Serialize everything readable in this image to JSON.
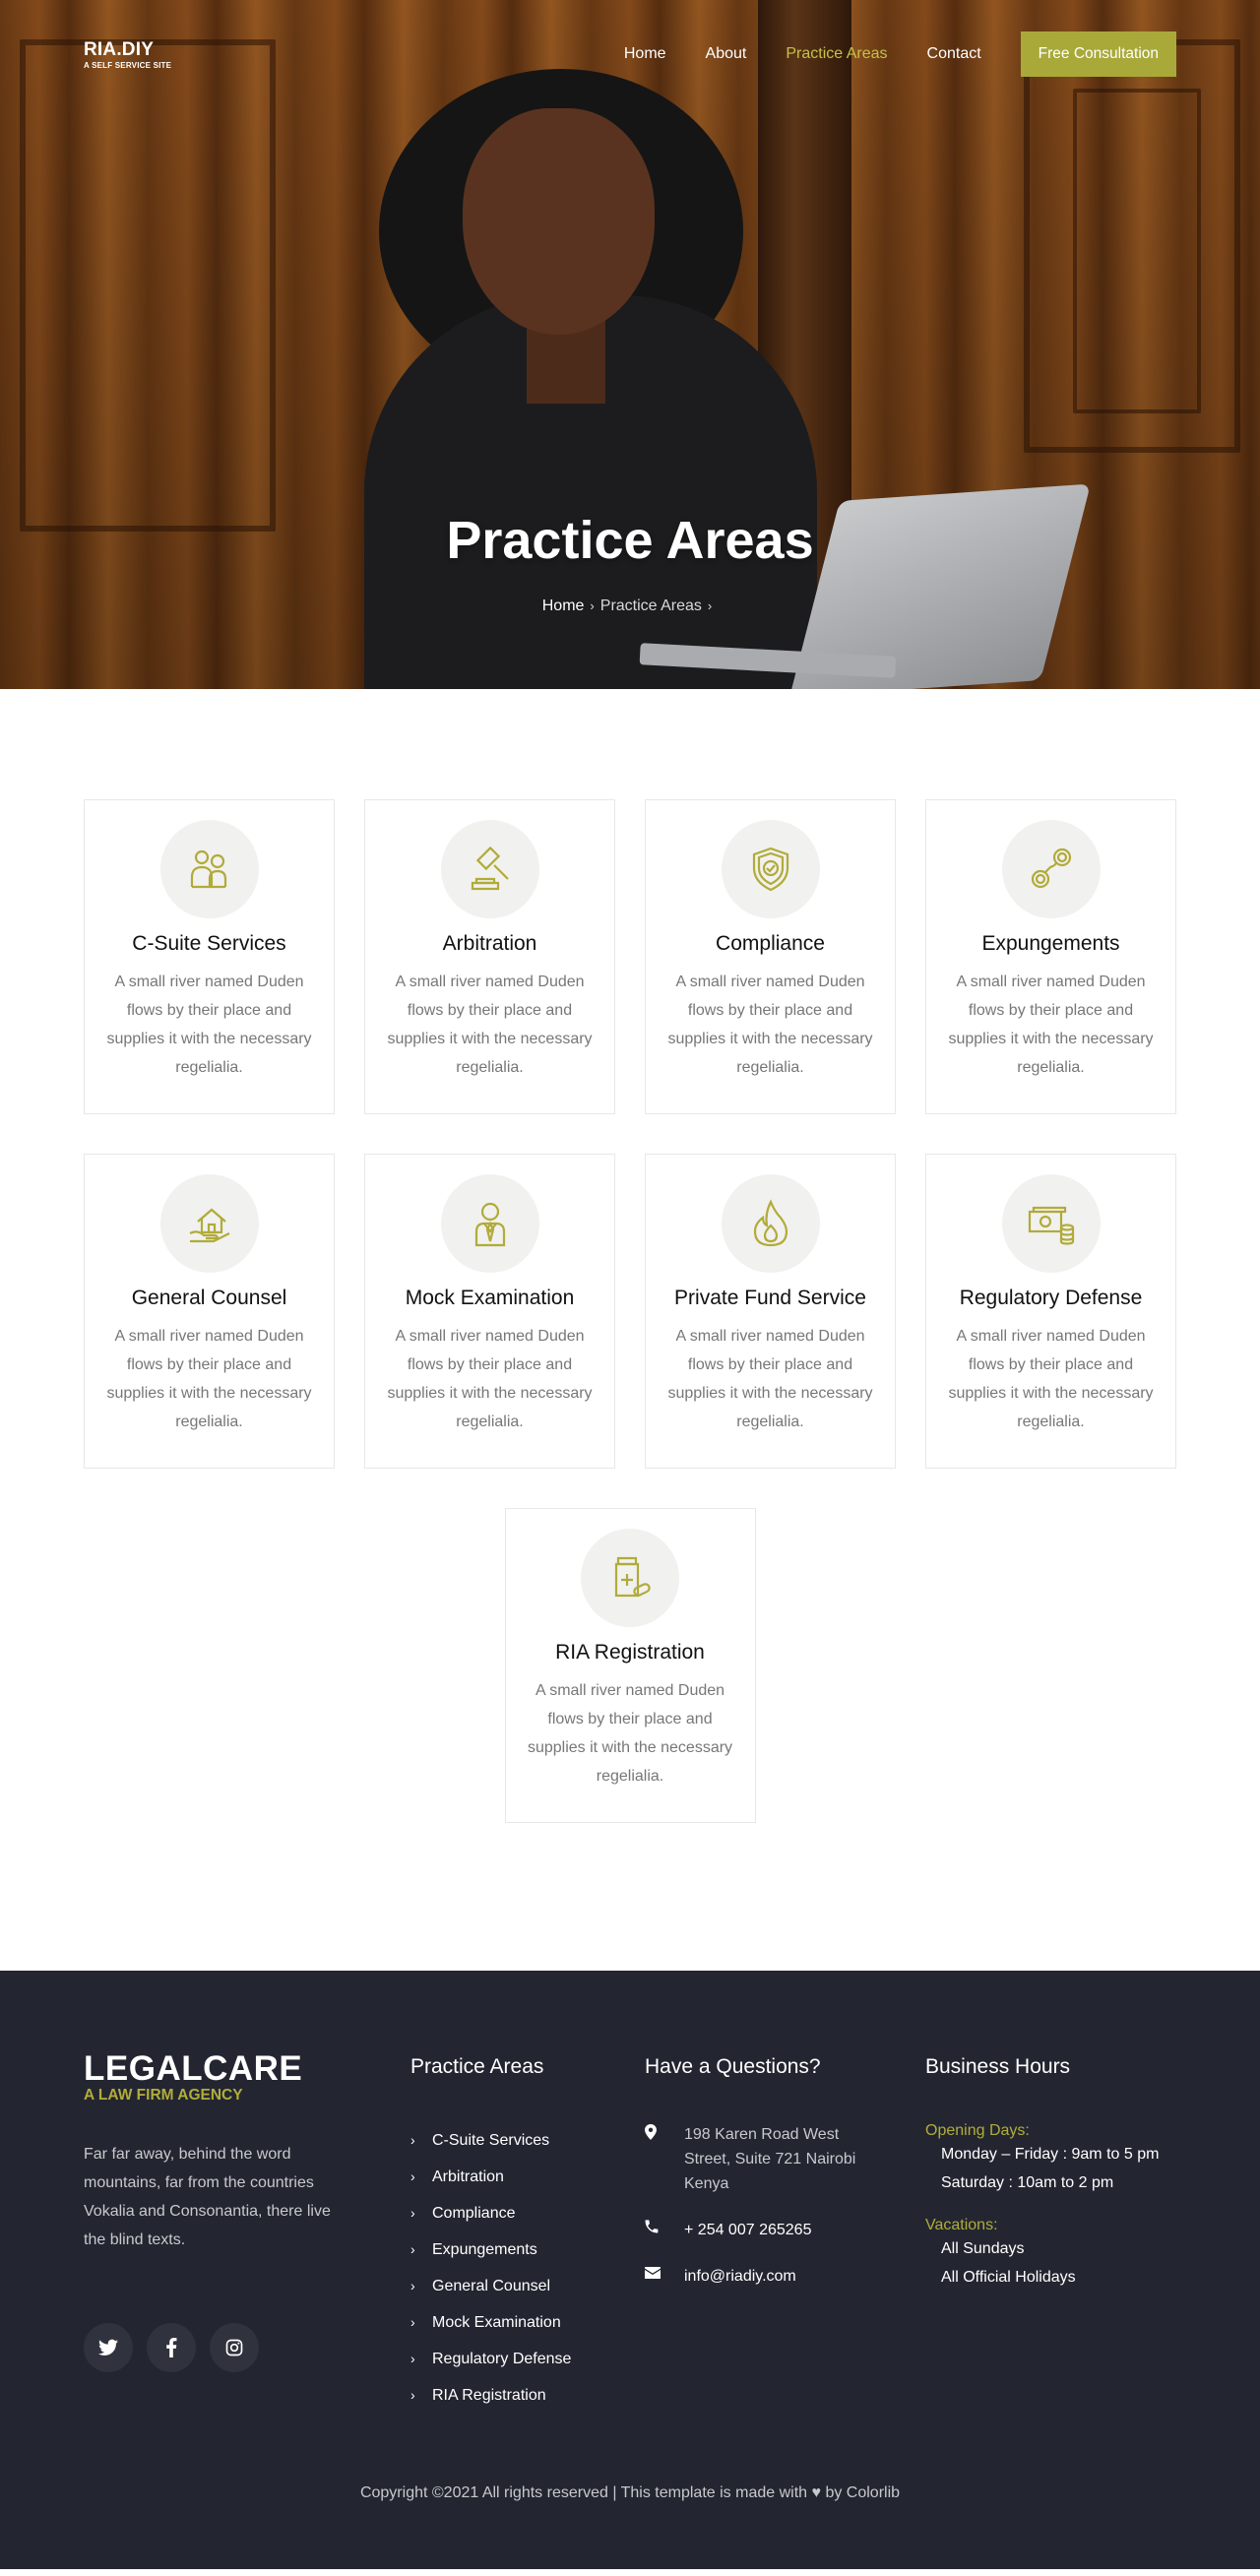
{
  "nav": {
    "brand_name": "RIA.DIY",
    "brand_tagline": "A SELF SERVICE SITE",
    "items": [
      {
        "label": "Home"
      },
      {
        "label": "About"
      },
      {
        "label": "Practice Areas"
      },
      {
        "label": "Contact"
      }
    ],
    "active_item": "Practice Areas",
    "cta_label": "Free Consultation"
  },
  "hero": {
    "title": "Practice Areas",
    "breadcrumb": [
      "Home",
      "Practice Areas"
    ]
  },
  "services": [
    {
      "title": "C-Suite Services",
      "desc": "A small river named Duden flows by their place and supplies it with the necessary regelialia.",
      "icon": "people-icon"
    },
    {
      "title": "Arbitration",
      "desc": "A small river named Duden flows by their place and supplies it with the necessary regelialia.",
      "icon": "gavel-icon"
    },
    {
      "title": "Compliance",
      "desc": "A small river named Duden flows by their place and supplies it with the necessary regelialia.",
      "icon": "shield-check-icon"
    },
    {
      "title": "Expungements",
      "desc": "A small river named Duden flows by their place and supplies it with the necessary regelialia.",
      "icon": "handcuffs-icon"
    },
    {
      "title": "General Counsel",
      "desc": "A small river named Duden flows by their place and supplies it with the necessary regelialia.",
      "icon": "house-hand-icon"
    },
    {
      "title": "Mock Examination",
      "desc": "A small river named Duden flows by their place and supplies it with the necessary regelialia.",
      "icon": "lawyer-icon"
    },
    {
      "title": "Private Fund Service",
      "desc": "A small river named Duden flows by their place and supplies it with the necessary regelialia.",
      "icon": "fire-icon"
    },
    {
      "title": "Regulatory Defense",
      "desc": "A small river named Duden flows by their place and supplies it with the necessary regelialia.",
      "icon": "money-icon"
    },
    {
      "title": "RIA Registration",
      "desc": "A small river named Duden flows by their place and supplies it with the necessary regelialia.",
      "icon": "medicine-icon"
    }
  ],
  "footer": {
    "logo_name": "LEGALCARE",
    "logo_tagline": "A LAW FIRM AGENCY",
    "description": "Far far away, behind the word mountains, far from the countries Vokalia and Consonantia, there live the blind texts.",
    "socials": [
      "twitter-icon",
      "facebook-icon",
      "instagram-icon"
    ],
    "practice_heading": "Practice Areas",
    "practice_links": [
      "C-Suite Services",
      "Arbitration",
      "Compliance",
      "Expungements",
      "General Counsel",
      "Mock Examination",
      "Regulatory Defense",
      "RIA Registration"
    ],
    "questions_heading": "Have a Questions?",
    "address": "198 Karen Road West Street, Suite 721 Nairobi Kenya",
    "phone": "+ 254 007 265265",
    "email": "info@riadiy.com",
    "hours_heading": "Business Hours",
    "opening_label": "Opening Days:",
    "opening_lines": [
      "Monday – Friday : 9am to 5 pm",
      "Saturday : 10am to 2 pm"
    ],
    "vacation_label": "Vacations:",
    "vacation_lines": [
      "All Sundays",
      "All Official Holidays"
    ],
    "copyright_before": "Copyright ©2021 All rights reserved | This template is made with",
    "copyright_after": "by Colorlib"
  },
  "colors": {
    "accent": "#a9a93a",
    "accent_text": "#b2ad3a",
    "footer_bg": "#232631"
  }
}
